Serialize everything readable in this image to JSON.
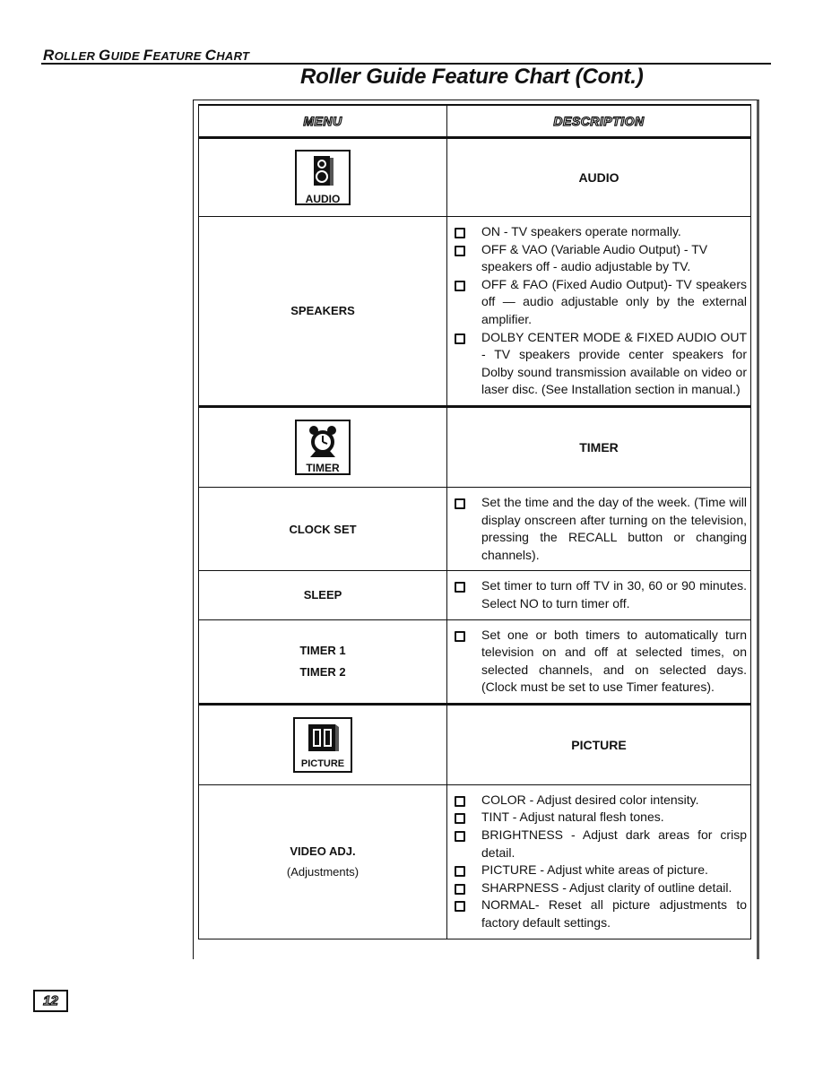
{
  "section_header": {
    "first_caps": [
      "R",
      "G",
      "F",
      "C"
    ],
    "text": "Roller Guide Feature Chart"
  },
  "page_title": "Roller Guide Feature Chart (Cont.)",
  "table": {
    "headers": {
      "menu": "Menu",
      "description": "Description"
    },
    "sections": [
      {
        "icon": "speaker-icon",
        "icon_label": "AUDIO",
        "title": "AUDIO",
        "rows": [
          {
            "menu": "SPEAKERS",
            "items": [
              "ON - TV speakers operate normally.",
              "OFF & VAO (Variable Audio Output) - TV speakers off - audio adjustable by TV.",
              "OFF & FAO (Fixed Audio Output)- TV speakers off — audio adjustable only by the external amplifier.",
              "DOLBY CENTER MODE & FIXED AUDIO OUT - TV speakers provide center speakers for Dolby sound transmission available on video or laser disc. (See Installation section in manual.)"
            ]
          }
        ]
      },
      {
        "icon": "alarm-clock-icon",
        "icon_label": "TIMER",
        "title": "TIMER",
        "rows": [
          {
            "menu": "CLOCK SET",
            "items": [
              "Set the time and the day of the week. (Time will display onscreen after turning on the television, pressing the RECALL button or changing channels)."
            ]
          },
          {
            "menu": "SLEEP",
            "items": [
              "Set timer to turn off TV in 30, 60 or 90 minutes. Select NO to turn timer off."
            ]
          },
          {
            "menu": "TIMER 1",
            "menu2": "TIMER 2",
            "items": [
              "Set one or both timers to automatically turn television on and off at selected times, on selected channels, and on selected days. (Clock must be set to use Timer features)."
            ]
          }
        ]
      },
      {
        "icon": "picture-tv-icon",
        "icon_label": "PICTURE",
        "title": "PICTURE",
        "rows": [
          {
            "menu": "VIDEO ADJ.",
            "menu_sub": "(Adjustments)",
            "items": [
              "COLOR - Adjust desired color intensity.",
              "TINT - Adjust natural flesh tones.",
              "BRIGHTNESS - Adjust dark areas for crisp detail.",
              "PICTURE - Adjust white areas of picture.",
              "SHARPNESS - Adjust clarity of outline detail.",
              "NORMAL- Reset all picture adjustments to factory default settings."
            ]
          }
        ]
      }
    ]
  },
  "page_number": "12"
}
